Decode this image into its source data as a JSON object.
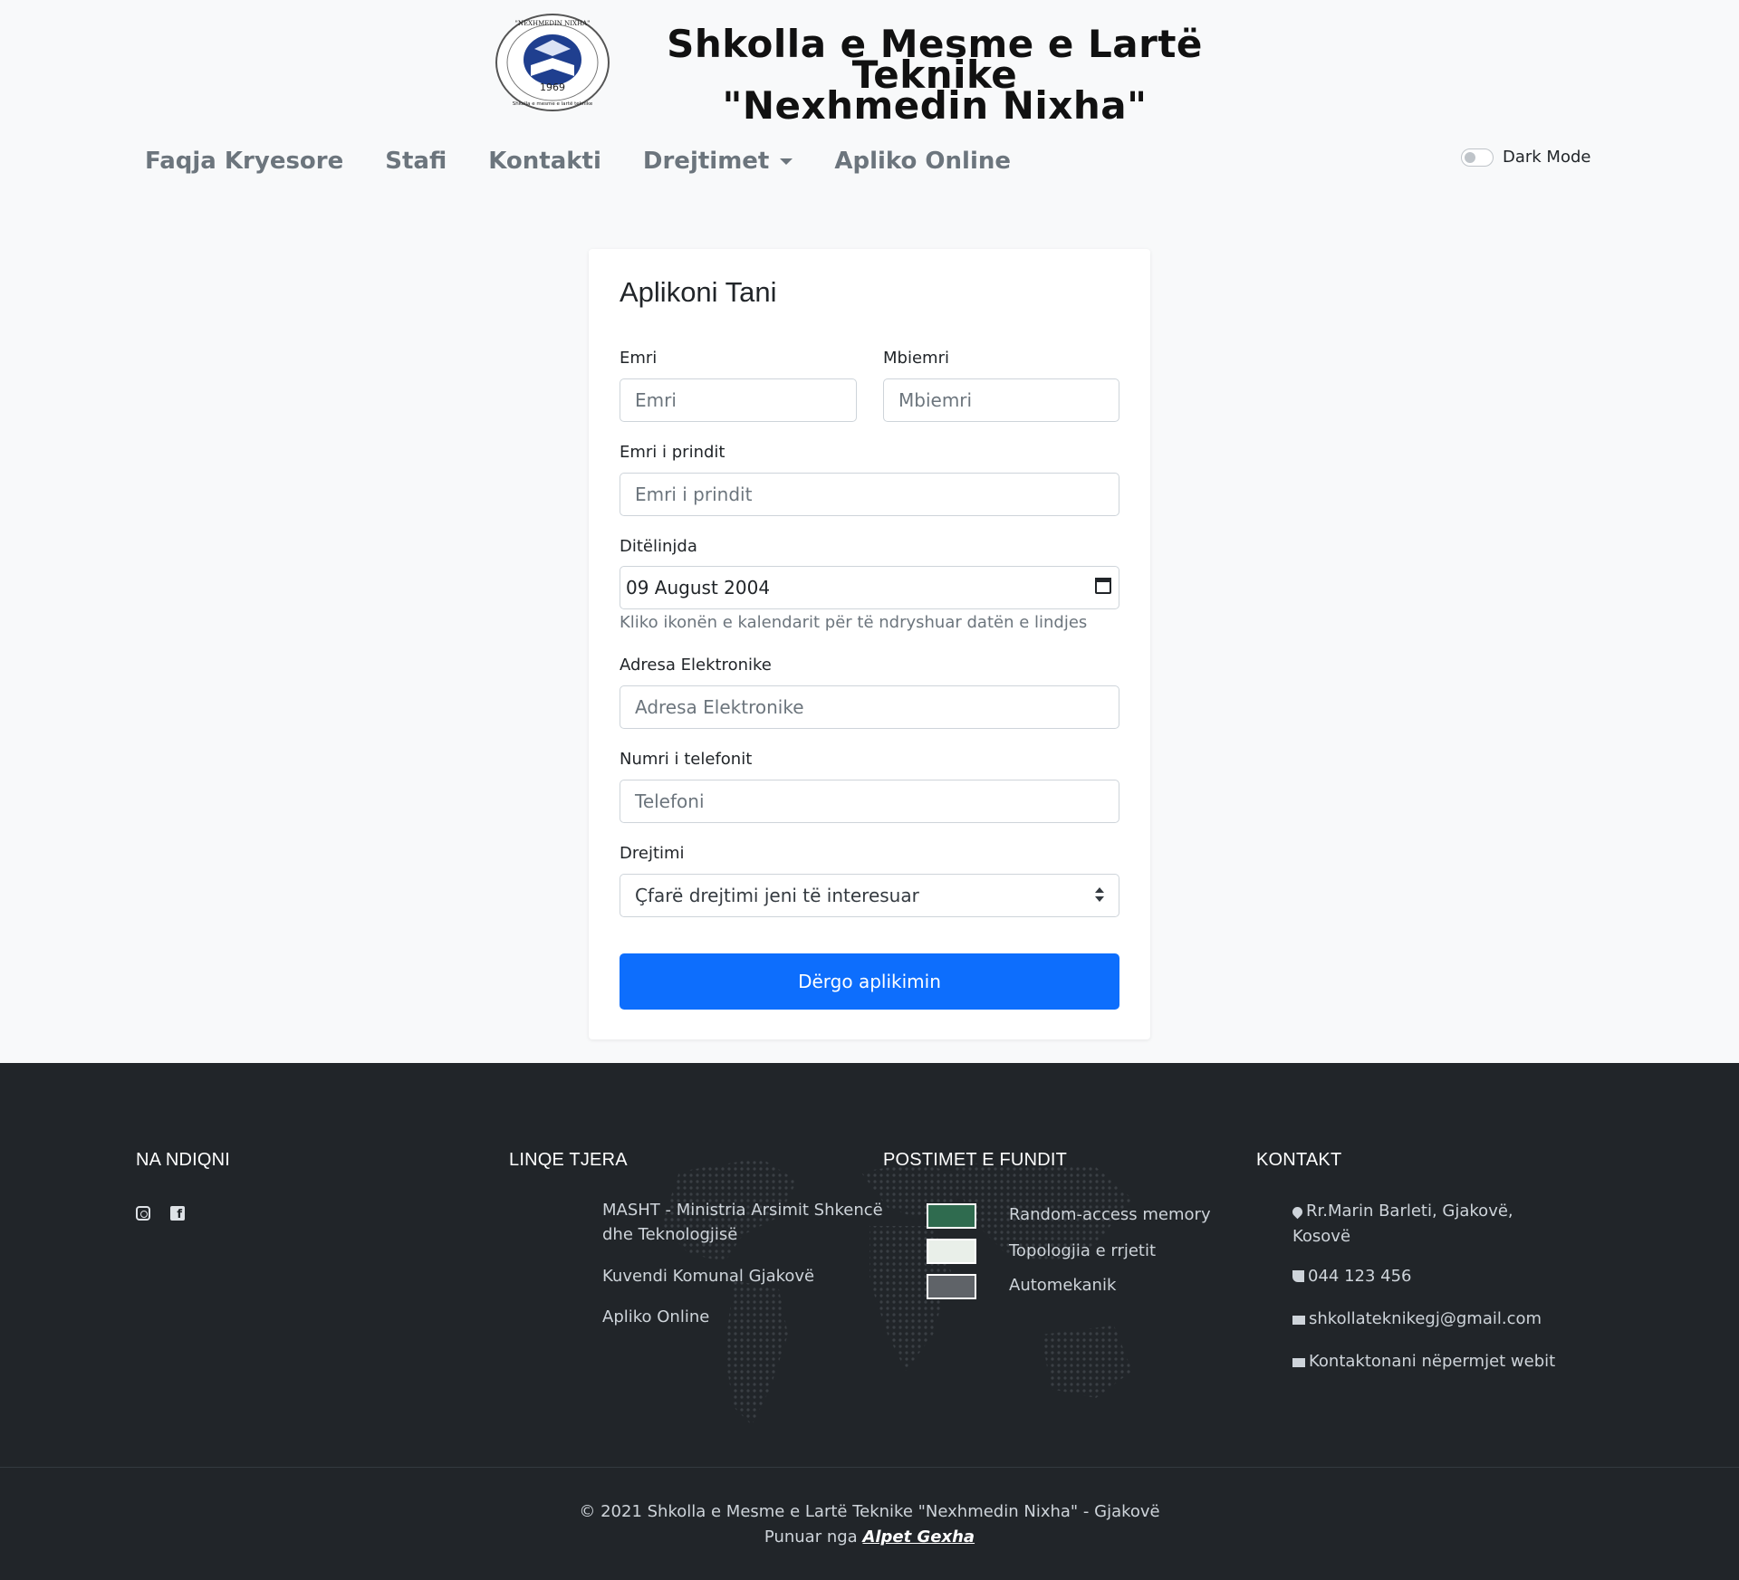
{
  "header": {
    "logo": {
      "top_text": "\"NEXHMEDIN NIXHA\"",
      "year": "1969",
      "bottom_text": "Shkolla e mesme e lartë teknike"
    },
    "title_line1": "Shkolla e Mesme e Lartë Teknike",
    "title_line2": "\"Nexhmedin Nixha\""
  },
  "nav": {
    "items": [
      {
        "label": "Faqja Kryesore"
      },
      {
        "label": "Stafi"
      },
      {
        "label": "Kontakti"
      },
      {
        "label": "Drejtimet"
      },
      {
        "label": "Apliko Online"
      }
    ],
    "dark_mode_label": "Dark Mode"
  },
  "form": {
    "title": "Aplikoni Tani",
    "first_name": {
      "label": "Emri",
      "placeholder": "Emri"
    },
    "last_name": {
      "label": "Mbiemri",
      "placeholder": "Mbiemri"
    },
    "parent_name": {
      "label": "Emri i prindit",
      "placeholder": "Emri i prindit"
    },
    "birthday": {
      "label": "Ditëlinjda",
      "value": "09 August 2004",
      "help": "Kliko ikonën e kalendarit për të ndryshuar datën e lindjes"
    },
    "email": {
      "label": "Adresa Elektronike",
      "placeholder": "Adresa Elektronike"
    },
    "phone": {
      "label": "Numri i telefonit",
      "placeholder": "Telefoni"
    },
    "direction": {
      "label": "Drejtimi",
      "selected": "Çfarë drejtimi jeni të interesuar"
    },
    "submit_label": "Dërgo aplikimin"
  },
  "footer": {
    "follow": {
      "title": "NA NDIQNI",
      "icons": [
        "instagram-icon",
        "facebook-icon"
      ]
    },
    "links": {
      "title": "LINQE TJERA",
      "items": [
        {
          "label_line1": "MASHT - Ministria Arsimit Shkencë",
          "label_line2": "dhe Teknologjisë"
        },
        {
          "label_line1": "Kuvendi Komunal Gjakovë"
        },
        {
          "label_line1": "Apliko Online"
        }
      ]
    },
    "posts": {
      "title": "POSTIMET E FUNDIT",
      "items": [
        {
          "label": "Random-access memory"
        },
        {
          "label": "Topologjia e rrjetit"
        },
        {
          "label": "Automekanik"
        }
      ]
    },
    "contact": {
      "title": "KONTAKT",
      "address_line1": "Rr.Marin Barleti, Gjakovë,",
      "address_line2": "Kosovë",
      "phone": "044 123 456",
      "email": "shkollateknikegj@gmail.com",
      "web": "Kontaktonani nëpermjet webit"
    },
    "copyright": "© 2021 Shkolla e Mesme e Lartë Teknike \"Nexhmedin Nixha\" - Gjakovë",
    "credit_prefix": "Punuar nga",
    "credit_name": "Alpet Gexha"
  },
  "colors": {
    "primary": "#0d6efd",
    "footer_bg": "#212529",
    "page_bg": "#f8f9fa"
  }
}
